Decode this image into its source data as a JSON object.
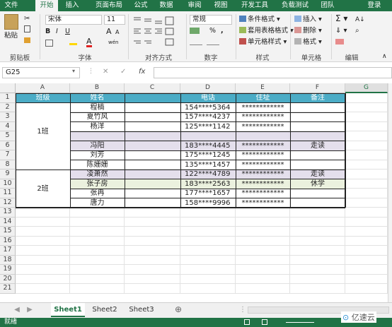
{
  "ribbon_tabs": [
    "文件",
    "开始",
    "插入",
    "页面布局",
    "公式",
    "数据",
    "审阅",
    "视图",
    "开发工具",
    "负载测试",
    "团队"
  ],
  "login": "登录",
  "clipboard": {
    "paste": "粘贴",
    "label": "剪贴板"
  },
  "font": {
    "name": "宋体",
    "size": "11",
    "bold": "B",
    "italic": "I",
    "underline": "U",
    "grow": "A",
    "shrink": "A",
    "label": "字体",
    "wen": "wén"
  },
  "alignment": {
    "label": "对齐方式"
  },
  "number": {
    "format": "常规",
    "percent": "%",
    "comma": ",",
    "label": "数字"
  },
  "styles": {
    "conditional": "条件格式",
    "table": "套用表格格式",
    "cell": "单元格样式",
    "label": "样式"
  },
  "cells": {
    "insert": "插入",
    "delete": "删除",
    "format": "格式",
    "label": "单元格"
  },
  "editing": {
    "label": "编辑"
  },
  "formula_bar": {
    "name_box": "G25",
    "fx": "fx",
    "cancel": "✕",
    "confirm": "✓"
  },
  "columns": [
    "A",
    "B",
    "C",
    "D",
    "E",
    "F",
    "G"
  ],
  "rows": [
    "1",
    "2",
    "3",
    "4",
    "5",
    "6",
    "7",
    "8",
    "9",
    "10",
    "11",
    "12",
    "13",
    "14",
    "15",
    "16",
    "17",
    "18",
    "19",
    "20",
    "21"
  ],
  "table": {
    "headers": [
      "班级",
      "姓名",
      "",
      "电话",
      "住址",
      "备注"
    ],
    "class1": "1班",
    "class2": "2班",
    "names": [
      "程楠",
      "夏竹风",
      "杨洋",
      "",
      "冯阳",
      "刘芳",
      "陈姗姗",
      "凌萧然",
      "张子房",
      "张冉",
      "唐力"
    ],
    "phones": [
      "154****5364",
      "157****4237",
      "125****1142",
      "",
      "183****4445",
      "175****1245",
      "135****1457",
      "122****4789",
      "183****2563",
      "177****1657",
      "158****9996"
    ],
    "addresses": [
      "************",
      "************",
      "************",
      "",
      "************",
      "************",
      "************",
      "************",
      "************",
      "************",
      "************"
    ],
    "notes": [
      "",
      "",
      "",
      "",
      "走读",
      "",
      "",
      "走读",
      "休学",
      "",
      ""
    ]
  },
  "sheets": [
    "Sheet1",
    "Sheet2",
    "Sheet3"
  ],
  "add_sheet": "⊕",
  "status": {
    "ready": "就绪",
    "watermark": "亿速云"
  },
  "colors": {
    "header_fill": "#4bacc6",
    "purple_fill": "#e4dfec",
    "green_fill": "#ebf1de",
    "excel_green": "#217346"
  }
}
